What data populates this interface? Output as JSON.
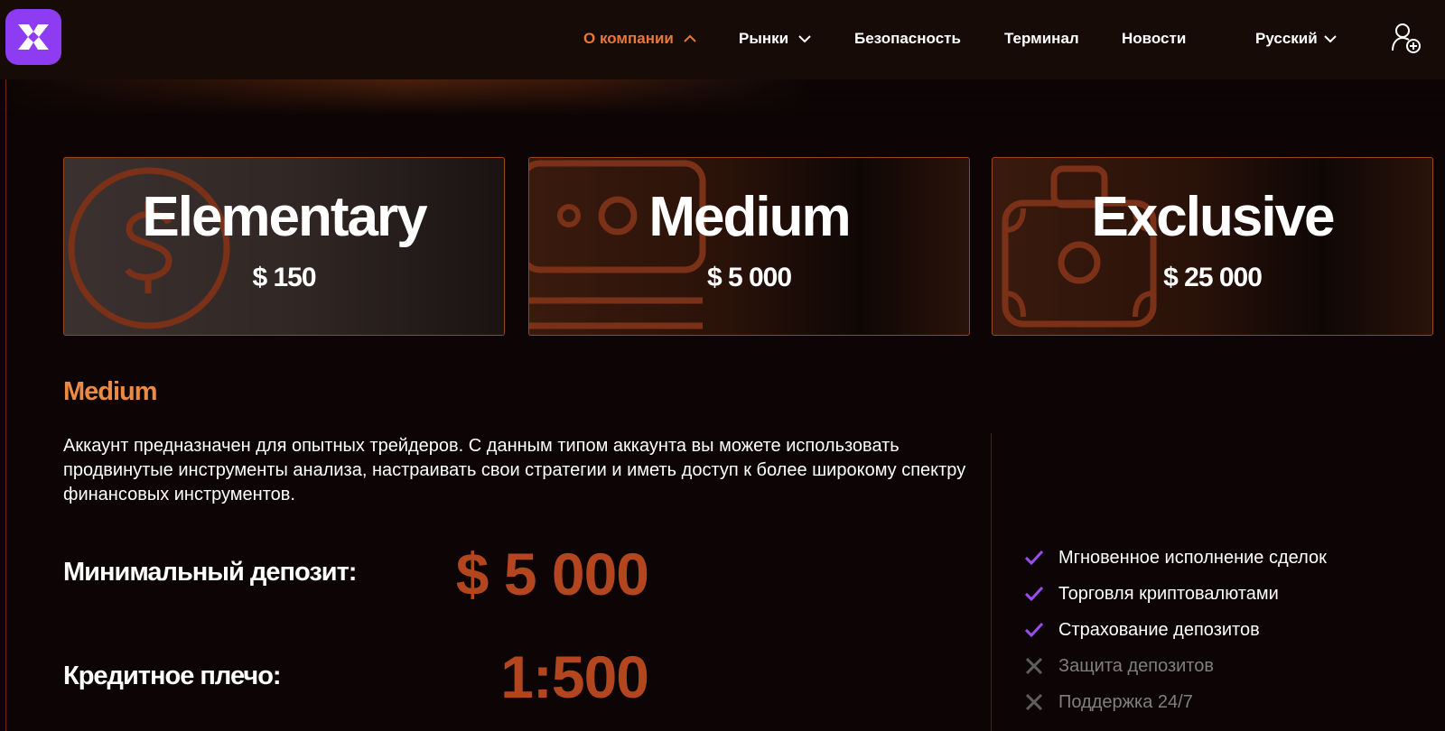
{
  "brand": {
    "logo_icon": "x-logo-icon",
    "logo_color": "#8d3cf2"
  },
  "nav": {
    "items": [
      {
        "label": "О компании",
        "active": true,
        "dropdown": "chevron-up-icon"
      },
      {
        "label": "Рынки",
        "active": false,
        "dropdown": "chevron-down-icon"
      },
      {
        "label": "Безопасность",
        "active": false
      },
      {
        "label": "Терминал",
        "active": false
      },
      {
        "label": "Новости",
        "active": false
      }
    ],
    "language": "Русский",
    "user_icon": "user-add-icon"
  },
  "plans": [
    {
      "name": "Elementary",
      "price": "$ 150",
      "icon": "dollar-coin-icon"
    },
    {
      "name": "Medium",
      "price": "$ 5 000",
      "icon": "banknote-icon"
    },
    {
      "name": "Exclusive",
      "price": "$ 25 000",
      "icon": "briefcase-icon"
    }
  ],
  "detail": {
    "title": "Medium",
    "description": "Аккаунт предназначен для опытных трейдеров. С данным типом аккаунта вы можете использовать продвинутые инструменты анализа, настраивать свои стратегии и иметь доступ к более широкому спектру финансовых инструментов.",
    "min_deposit_label": "Минимальный депозит:",
    "min_deposit_value": "$ 5 000",
    "leverage_label": "Кредитное плечо:",
    "leverage_value": "1:500"
  },
  "features": [
    {
      "text": "Мгновенное исполнение сделок",
      "included": true
    },
    {
      "text": "Торговля криптовалютами",
      "included": true
    },
    {
      "text": "Страхование депозитов",
      "included": true
    },
    {
      "text": "Защита депозитов",
      "included": false
    },
    {
      "text": "Поддержка 24/7",
      "included": false
    }
  ],
  "colors": {
    "accent_orange": "#e8773a",
    "value_orange": "#b4461f",
    "check_purple": "#9a4cf0",
    "background": "#0d0505"
  }
}
